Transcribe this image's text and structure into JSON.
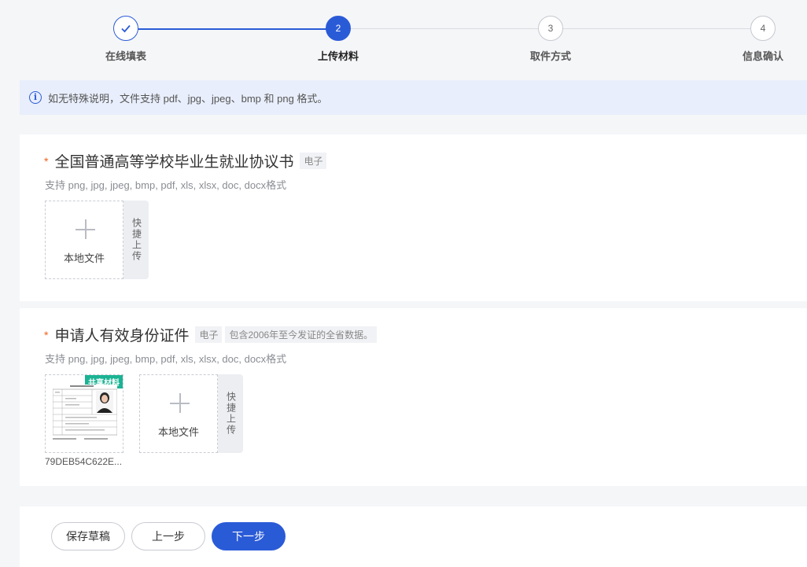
{
  "steps": [
    {
      "label": "在线填表",
      "number": "1",
      "status": "done"
    },
    {
      "label": "上传材料",
      "number": "2",
      "status": "active"
    },
    {
      "label": "取件方式",
      "number": "3",
      "status": "pending"
    },
    {
      "label": "信息确认",
      "number": "4",
      "status": "pending"
    }
  ],
  "notice": {
    "text": "如无特殊说明，文件支持 pdf、jpg、jpeg、bmp 和 png 格式。"
  },
  "materials": [
    {
      "required_mark": "*",
      "title": "全国普通高等学校毕业生就业协议书",
      "tags": [
        "电子"
      ],
      "hint": "支持 png, jpg, jpeg, bmp, pdf, xls, xlsx, doc, docx格式",
      "upload_label": "本地文件",
      "quick_upload": "快捷上传"
    },
    {
      "required_mark": "*",
      "title": "申请人有效身份证件",
      "tags": [
        "电子",
        "包含2006年至今发证的全省数据。"
      ],
      "hint": "支持 png, jpg, jpeg, bmp, pdf, xls, xlsx, doc, docx格式",
      "shared_badge": "共享材料",
      "file_name": "79DEB54C622E...",
      "upload_label": "本地文件",
      "quick_upload": "快捷上传"
    }
  ],
  "footer": {
    "save_draft": "保存草稿",
    "prev": "上一步",
    "next": "下一步"
  },
  "colors": {
    "primary": "#2a5bd7",
    "required": "#f0611b",
    "shared": "#1bb393"
  }
}
